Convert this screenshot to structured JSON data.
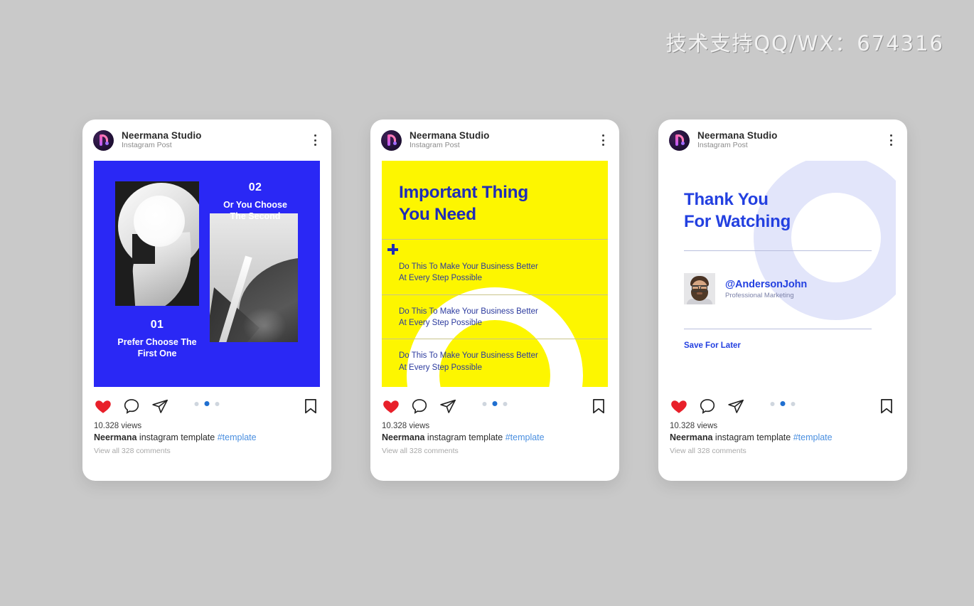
{
  "watermark": "技术支持QQ/WX：674316",
  "colors": {
    "page_background": "#c9c9c9",
    "brand_blue": "#2a28f5",
    "accent_yellow": "#fdf600",
    "text_blue": "#2340e0",
    "heart_red": "#e8202a",
    "dot_active": "#1f6fd0",
    "c_shape": "#e2e5fa"
  },
  "header": {
    "name": "Neermana Studio",
    "subtitle": "Instagram Post",
    "avatar_icon": "neermana-logo-icon",
    "menu_icon": "kebab-menu-icon"
  },
  "footer": {
    "icons": [
      "heart-icon",
      "comment-icon",
      "share-icon",
      "bookmark-icon"
    ],
    "views": "10.328 views",
    "caption_author": "Neermana",
    "caption_text": " instagram template ",
    "caption_tag": "#template",
    "comments": "View all 328 comments",
    "dots": {
      "count": 3,
      "active_index": 1
    }
  },
  "cards": [
    {
      "id": "card-1",
      "post_type": "numbered-choice",
      "background": "#2a28f5",
      "items": [
        {
          "number": "02",
          "caption": "Or You Choose\nThe Second"
        },
        {
          "number": "01",
          "caption": "Prefer Choose The\nFirst One"
        }
      ],
      "photos": [
        "abstract-spiral-sculpture",
        "abstract-architecture-angles"
      ]
    },
    {
      "id": "card-2",
      "post_type": "checklist",
      "background": "#fdf600",
      "heading": "Important Thing\nYou Need",
      "plus_icon": "plus-icon",
      "rows": [
        "Do This To Make Your Business Better\nAt Every Step Possible",
        "Do This To Make Your Business Better\nAt Every Step Possible",
        "Do This To Make Your Business Better\nAt Every Step Possible"
      ]
    },
    {
      "id": "card-3",
      "post_type": "thank-you",
      "background": "#ffffff",
      "heading": "Thank You\nFor Watching",
      "user_handle": "@AndersonJohn",
      "user_role": "Professional Marketing",
      "user_avatar": "profile-photo",
      "cta": "Save For Later",
      "decoration": "c-ring-shape"
    }
  ]
}
